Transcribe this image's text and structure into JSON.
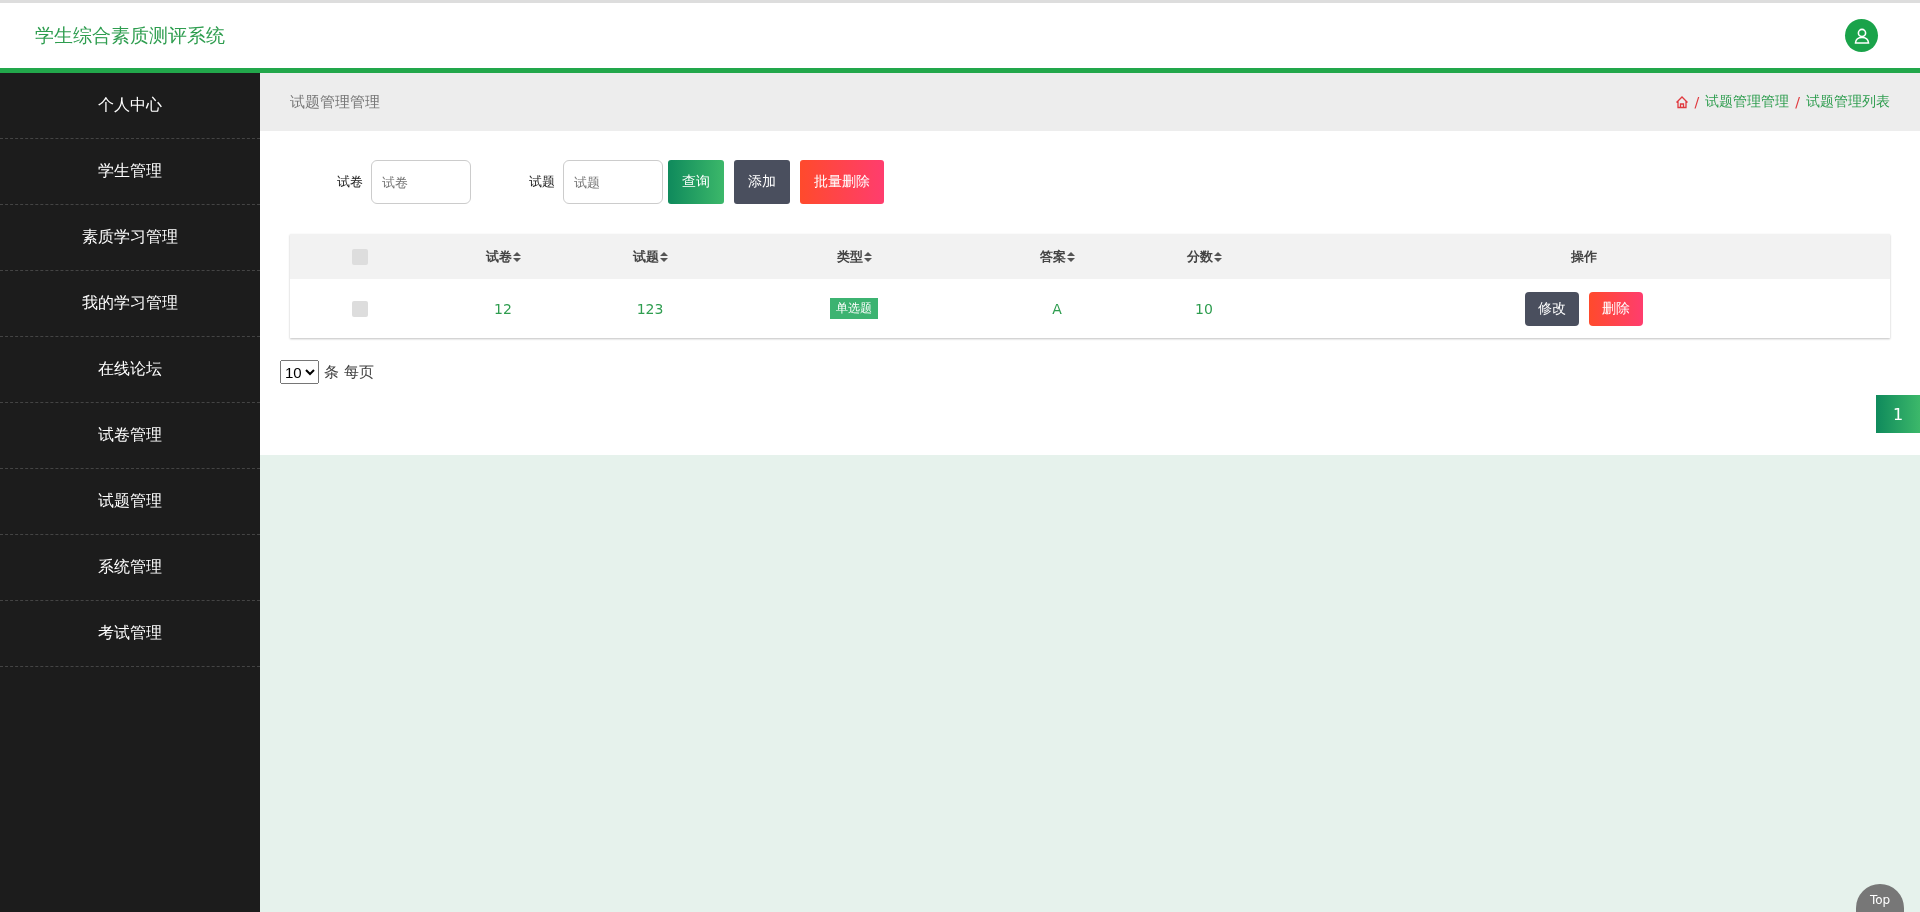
{
  "header": {
    "title": "学生综合素质测评系统"
  },
  "sidebar": {
    "items": [
      {
        "label": "个人中心"
      },
      {
        "label": "学生管理"
      },
      {
        "label": "素质学习管理"
      },
      {
        "label": "我的学习管理"
      },
      {
        "label": "在线论坛"
      },
      {
        "label": "试卷管理"
      },
      {
        "label": "试题管理"
      },
      {
        "label": "系统管理"
      },
      {
        "label": "考试管理"
      }
    ]
  },
  "breadcrumb_bar": {
    "page_title": "试题管理管理",
    "separator": "/",
    "crumbs": [
      "试题管理管理",
      "试题管理列表"
    ]
  },
  "search": {
    "fields": [
      {
        "label": "试卷",
        "placeholder": "试卷"
      },
      {
        "label": "试题",
        "placeholder": "试题"
      }
    ],
    "buttons": [
      {
        "label": "查询",
        "kind": "query"
      },
      {
        "label": "添加",
        "kind": "add"
      },
      {
        "label": "批量删除",
        "kind": "delete"
      }
    ]
  },
  "table": {
    "header_checkbox": {
      "checked": false
    },
    "columns": [
      {
        "label": "试卷",
        "sortable": true
      },
      {
        "label": "试题",
        "sortable": true
      },
      {
        "label": "类型",
        "sortable": true
      },
      {
        "label": "答案",
        "sortable": true
      },
      {
        "label": "分数",
        "sortable": true
      },
      {
        "label": "操作",
        "sortable": false
      }
    ],
    "rows": [
      {
        "checked": false,
        "cells": [
          {
            "kind": "text",
            "text": "12"
          },
          {
            "kind": "text",
            "text": "123"
          },
          {
            "kind": "tag",
            "text": "单选题"
          },
          {
            "kind": "text",
            "text": "A"
          },
          {
            "kind": "text",
            "text": "10"
          }
        ],
        "actions": [
          {
            "label": "修改",
            "kind": "edit"
          },
          {
            "label": "删除",
            "kind": "delete"
          }
        ]
      }
    ]
  },
  "pagination": {
    "page_size": "10",
    "page_size_label": "条 每页",
    "pages": [
      {
        "label": "1",
        "selected": true
      }
    ]
  },
  "back_to_top": {
    "label": "Top"
  }
}
